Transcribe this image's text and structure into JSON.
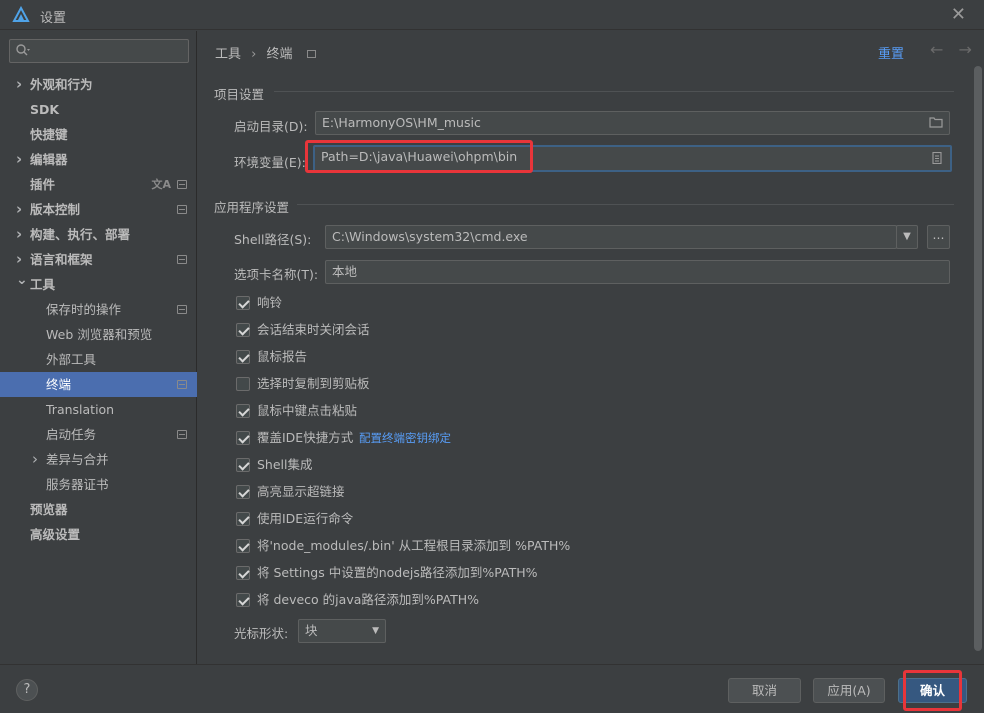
{
  "window": {
    "title": "设置",
    "close": "✕"
  },
  "search": {
    "placeholder": ""
  },
  "sidebar": {
    "items": [
      {
        "label": "外观和行为",
        "bold": true,
        "expandable": true,
        "expanded": false
      },
      {
        "label": "SDK",
        "bold": true
      },
      {
        "label": "快捷键",
        "bold": true
      },
      {
        "label": "编辑器",
        "bold": true,
        "expandable": true,
        "expanded": false
      },
      {
        "label": "插件",
        "bold": true,
        "badge": true,
        "lang": "文A"
      },
      {
        "label": "版本控制",
        "bold": true,
        "expandable": true,
        "expanded": false,
        "badge": true
      },
      {
        "label": "构建、执行、部署",
        "bold": true,
        "expandable": true,
        "expanded": false
      },
      {
        "label": "语言和框架",
        "bold": true,
        "expandable": true,
        "expanded": false,
        "badge": true
      },
      {
        "label": "工具",
        "bold": true,
        "expandable": true,
        "expanded": true
      },
      {
        "label": "保存时的操作",
        "badge": true
      },
      {
        "label": "Web 浏览器和预览"
      },
      {
        "label": "外部工具"
      },
      {
        "label": "终端",
        "selected": true,
        "badge": true
      },
      {
        "label": "Translation"
      },
      {
        "label": "启动任务",
        "badge": true
      },
      {
        "label": "差异与合并",
        "expandable": true,
        "expanded": false
      },
      {
        "label": "服务器证书"
      },
      {
        "label": "预览器",
        "bold": true
      },
      {
        "label": "高级设置",
        "bold": true
      }
    ]
  },
  "breadcrumb": {
    "parent": "工具",
    "separator": "›",
    "current": "终端"
  },
  "header": {
    "reset": "重置",
    "back": "←",
    "forward": "→"
  },
  "project_settings": {
    "title": "项目设置",
    "start_dir_label": "启动目录(D):",
    "start_dir_value": "E:\\HarmonyOS\\HM_music",
    "env_label": "环境变量(E):",
    "env_value": "Path=D:\\java\\Huawei\\ohpm\\bin"
  },
  "app_settings": {
    "title": "应用程序设置",
    "shell_label": "Shell路径(S):",
    "shell_value": "C:\\Windows\\system32\\cmd.exe",
    "browse": "...",
    "tab_name_label": "选项卡名称(T):",
    "tab_name_value": "本地",
    "checkboxes": [
      {
        "label": "响铃",
        "checked": true
      },
      {
        "label": "会话结束时关闭会话",
        "checked": true
      },
      {
        "label": "鼠标报告",
        "checked": true
      },
      {
        "label": "选择时复制到剪贴板",
        "checked": false
      },
      {
        "label": "鼠标中键点击粘贴",
        "checked": true
      },
      {
        "label": "覆盖IDE快捷方式",
        "checked": true,
        "link": "配置终端密钥绑定"
      },
      {
        "label": "Shell集成",
        "checked": true
      },
      {
        "label": "高亮显示超链接",
        "checked": true
      },
      {
        "label": "使用IDE运行命令",
        "checked": true
      },
      {
        "label": "将'node_modules/.bin' 从工程根目录添加到 %PATH%",
        "checked": true
      },
      {
        "label": "将 Settings 中设置的nodejs路径添加到%PATH%",
        "checked": true
      },
      {
        "label": "将 deveco 的java路径添加到%PATH%",
        "checked": true
      }
    ],
    "cursor_shape_label": "光标形状:",
    "cursor_shape_value": "块"
  },
  "footer": {
    "help": "?",
    "cancel": "取消",
    "apply": "应用(A)",
    "ok": "确认"
  },
  "colors": {
    "accent": "#4b6eaf",
    "link": "#589df6",
    "highlight": "#e8353a",
    "primary": "#365880"
  }
}
